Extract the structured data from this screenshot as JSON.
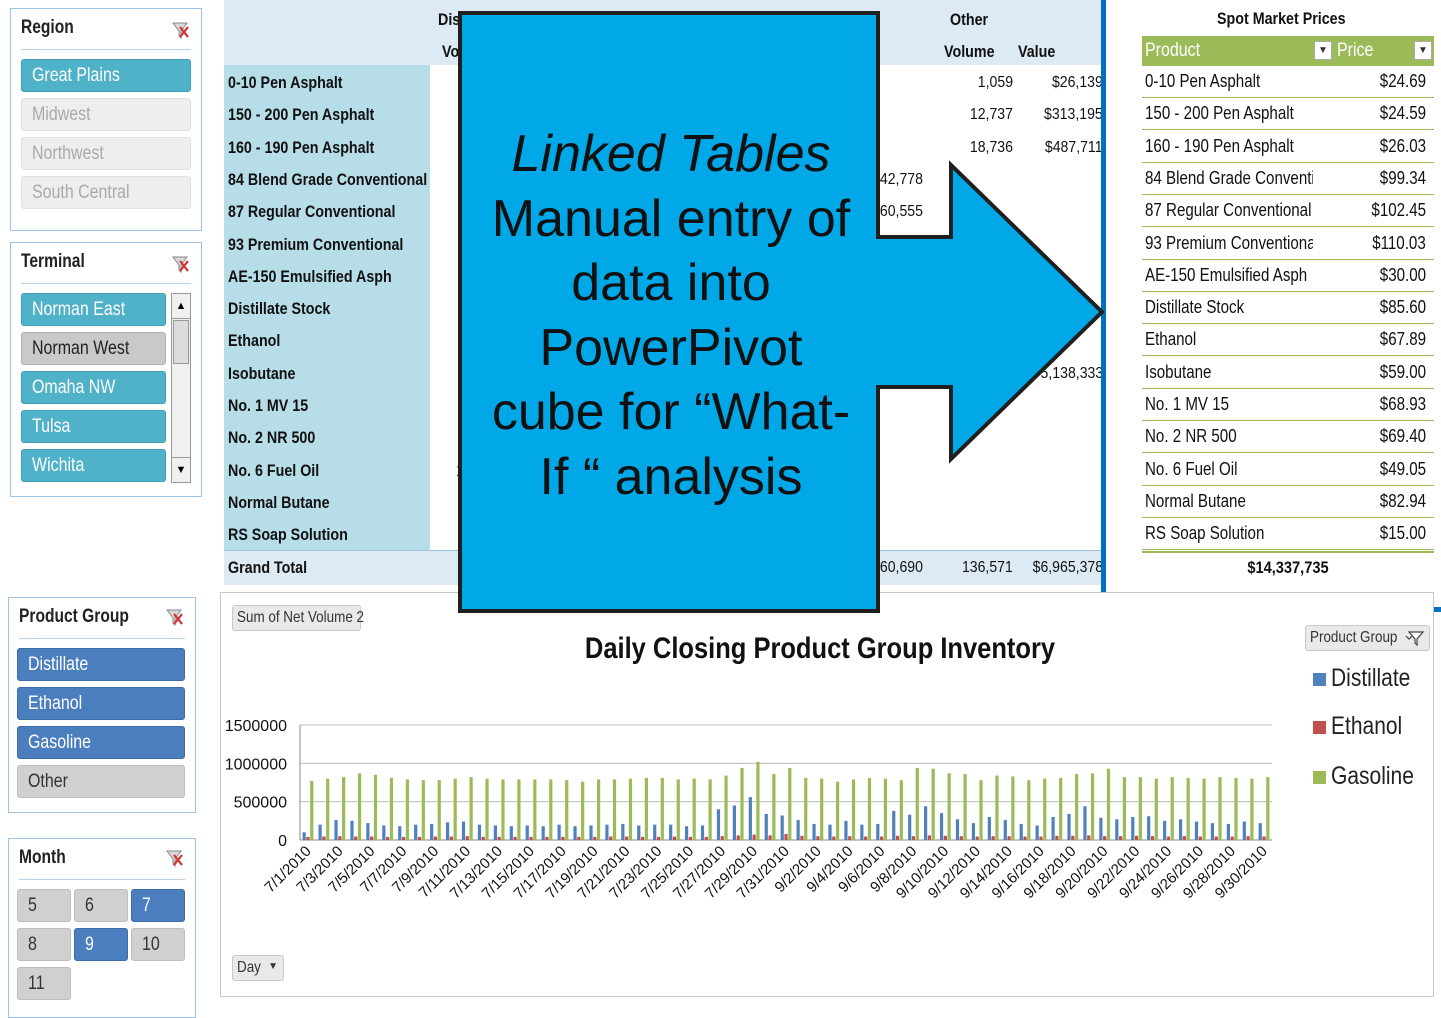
{
  "region_slicer": {
    "title": "Region",
    "items": [
      {
        "label": "Great Plains",
        "state": "selected"
      },
      {
        "label": "Midwest",
        "state": "nodata"
      },
      {
        "label": "Northwest",
        "state": "nodata"
      },
      {
        "label": "South Central",
        "state": "nodata"
      }
    ]
  },
  "terminal_slicer": {
    "title": "Terminal",
    "items": [
      {
        "label": "Norman East",
        "state": "selected"
      },
      {
        "label": "Norman West",
        "state": "unselected"
      },
      {
        "label": "Omaha NW",
        "state": "selected"
      },
      {
        "label": "Tulsa",
        "state": "selected"
      },
      {
        "label": "Wichita",
        "state": "selected"
      }
    ]
  },
  "product_group_slicer": {
    "title": "Product Group",
    "items": [
      {
        "label": "Distillate",
        "state": "selected"
      },
      {
        "label": "Ethanol",
        "state": "selected"
      },
      {
        "label": "Gasoline",
        "state": "selected"
      },
      {
        "label": "Other",
        "state": "unselected"
      }
    ]
  },
  "month_slicer": {
    "title": "Month",
    "items": [
      {
        "label": "5",
        "state": "unselected"
      },
      {
        "label": "6",
        "state": "unselected"
      },
      {
        "label": "7",
        "state": "selected"
      },
      {
        "label": "8",
        "state": "unselected"
      },
      {
        "label": "9",
        "state": "selected"
      },
      {
        "label": "10",
        "state": "unselected"
      },
      {
        "label": "11",
        "state": "unselected"
      }
    ]
  },
  "pivot": {
    "header_top_left": "Dis",
    "header_sub_left": "Vo",
    "header_other": "Other",
    "header_volume": "Volume",
    "header_value": "Value",
    "rows": [
      {
        "label": "0-10 Pen Asphalt",
        "mid": "",
        "volume": "1,059",
        "value": "$26,139"
      },
      {
        "label": "150 - 200 Pen Asphalt",
        "mid": "",
        "volume": "12,737",
        "value": "$313,195"
      },
      {
        "label": "160 - 190 Pen Asphalt",
        "mid": "",
        "volume": "18,736",
        "value": "$487,711"
      },
      {
        "label": "84 Blend Grade Conventional",
        "mid": "42,778",
        "volume": "",
        "value": ""
      },
      {
        "label": "87 Regular Conventional",
        "mid": "60,555",
        "volume": "",
        "value": ""
      },
      {
        "label": "93 Premium Conventional",
        "mid": "",
        "volume": "",
        "value": ""
      },
      {
        "label": "AE-150 Emulsified Asph",
        "mid": "",
        "volume": "",
        "value": ""
      },
      {
        "label": "Distillate Stock",
        "mid": "",
        "volume": "",
        "value": ""
      },
      {
        "label": "Ethanol",
        "mid": "",
        "volume": "",
        "value": ""
      },
      {
        "label": "Isobutane",
        "mid": "",
        "volume": "",
        "value": "5,138,333"
      },
      {
        "label": "No. 1 MV 15",
        "mid": "",
        "volume": "",
        "value": ""
      },
      {
        "label": "No. 2 NR 500",
        "mid": "",
        "volume": "",
        "value": ""
      },
      {
        "label": "No. 6 Fuel Oil",
        "mid": "",
        "volume": "",
        "value": ""
      },
      {
        "label": "Normal Butane",
        "mid": "",
        "volume": "",
        "value": ""
      },
      {
        "label": "RS Soap Solution",
        "mid": "",
        "volume": "",
        "value": ""
      }
    ],
    "grand_total_label": "Grand Total",
    "grand_total_mid": "60,690",
    "grand_total_volume": "136,571",
    "grand_total_value": "$6,965,378",
    "left_fragment_row_12": "1"
  },
  "callout": {
    "line1": "Linked Tables",
    "line2": "Manual entry of",
    "line3": "data into",
    "line4": "PowerPivot",
    "line5": "cube for “What-",
    "line6": "If “ analysis"
  },
  "spot": {
    "title": "Spot Market Prices",
    "col_product": "Product",
    "col_price": "Price",
    "rows": [
      {
        "product": "0-10 Pen Asphalt",
        "price": "$24.69"
      },
      {
        "product": "150 - 200 Pen Asphalt",
        "price": "$24.59"
      },
      {
        "product": "160 - 190 Pen Asphalt",
        "price": "$26.03"
      },
      {
        "product": "84 Blend Grade Conventional",
        "price": "$99.34"
      },
      {
        "product": "87 Regular Conventional",
        "price": "$102.45"
      },
      {
        "product": "93 Premium Conventional",
        "price": "$110.03"
      },
      {
        "product": "AE-150 Emulsified Asph",
        "price": "$30.00"
      },
      {
        "product": "Distillate Stock",
        "price": "$85.60"
      },
      {
        "product": "Ethanol",
        "price": "$67.89"
      },
      {
        "product": "Isobutane",
        "price": "$59.00"
      },
      {
        "product": "No. 1 MV 15",
        "price": "$68.93"
      },
      {
        "product": "No. 2 NR 500",
        "price": "$69.40"
      },
      {
        "product": "No. 6 Fuel Oil",
        "price": "$49.05"
      },
      {
        "product": "Normal Butane",
        "price": "$82.94"
      },
      {
        "product": "RS Soap Solution",
        "price": "$15.00"
      }
    ],
    "total": "$14,337,735"
  },
  "chart_controls": {
    "value_field": "Sum of Net Volume 2",
    "legend_filter": "Product Group",
    "axis_field": "Day"
  },
  "colors": {
    "distillate": "#4f81bd",
    "ethanol": "#c0504d",
    "gasoline": "#9bbb59",
    "spot_header": "#9bbb59",
    "callout": "#00a8e8"
  },
  "chart_data": {
    "type": "bar",
    "title": "Daily Closing Product Group Inventory",
    "ylim": [
      0,
      1500000
    ],
    "yticks": [
      0,
      500000,
      1000000,
      1500000
    ],
    "x": [
      "7/1/2010",
      "7/2/2010",
      "7/3/2010",
      "7/4/2010",
      "7/5/2010",
      "7/6/2010",
      "7/7/2010",
      "7/8/2010",
      "7/9/2010",
      "7/10/2010",
      "7/11/2010",
      "7/12/2010",
      "7/13/2010",
      "7/14/2010",
      "7/15/2010",
      "7/16/2010",
      "7/17/2010",
      "7/18/2010",
      "7/19/2010",
      "7/20/2010",
      "7/21/2010",
      "7/22/2010",
      "7/23/2010",
      "7/24/2010",
      "7/25/2010",
      "7/26/2010",
      "7/27/2010",
      "7/28/2010",
      "7/29/2010",
      "7/30/2010",
      "7/31/2010",
      "9/1/2010",
      "9/2/2010",
      "9/3/2010",
      "9/4/2010",
      "9/5/2010",
      "9/6/2010",
      "9/7/2010",
      "9/8/2010",
      "9/9/2010",
      "9/10/2010",
      "9/11/2010",
      "9/12/2010",
      "9/13/2010",
      "9/14/2010",
      "9/15/2010",
      "9/16/2010",
      "9/17/2010",
      "9/18/2010",
      "9/19/2010",
      "9/20/2010",
      "9/21/2010",
      "9/22/2010",
      "9/23/2010",
      "9/24/2010",
      "9/25/2010",
      "9/26/2010",
      "9/27/2010",
      "9/28/2010",
      "9/29/2010",
      "9/30/2010"
    ],
    "x_tick_labels": [
      "7/1/2010",
      "7/3/2010",
      "7/5/2010",
      "7/7/2010",
      "7/9/2010",
      "7/11/2010",
      "7/13/2010",
      "7/15/2010",
      "7/17/2010",
      "7/19/2010",
      "7/21/2010",
      "7/23/2010",
      "7/25/2010",
      "7/27/2010",
      "7/29/2010",
      "7/31/2010",
      "9/2/2010",
      "9/4/2010",
      "9/6/2010",
      "9/8/2010",
      "9/10/2010",
      "9/12/2010",
      "9/14/2010",
      "9/16/2010",
      "9/18/2010",
      "9/20/2010",
      "9/22/2010",
      "9/24/2010",
      "9/26/2010",
      "9/28/2010",
      "9/30/2010"
    ],
    "series": [
      {
        "name": "Distillate",
        "values": [
          100000,
          200000,
          260000,
          250000,
          220000,
          190000,
          180000,
          200000,
          210000,
          230000,
          240000,
          200000,
          190000,
          180000,
          190000,
          180000,
          200000,
          180000,
          190000,
          200000,
          210000,
          190000,
          200000,
          200000,
          180000,
          190000,
          400000,
          450000,
          560000,
          340000,
          320000,
          260000,
          210000,
          200000,
          250000,
          200000,
          210000,
          380000,
          330000,
          440000,
          350000,
          270000,
          220000,
          300000,
          260000,
          210000,
          190000,
          300000,
          340000,
          440000,
          290000,
          270000,
          300000,
          310000,
          250000,
          270000,
          240000,
          220000,
          210000,
          240000,
          220000
        ]
      },
      {
        "name": "Ethanol",
        "values": [
          40000,
          45000,
          50000,
          45000,
          45000,
          40000,
          40000,
          40000,
          45000,
          45000,
          50000,
          40000,
          40000,
          40000,
          40000,
          40000,
          40000,
          40000,
          40000,
          45000,
          45000,
          40000,
          40000,
          45000,
          40000,
          40000,
          50000,
          60000,
          70000,
          60000,
          80000,
          55000,
          50000,
          45000,
          50000,
          45000,
          45000,
          55000,
          50000,
          60000,
          55000,
          50000,
          45000,
          50000,
          50000,
          45000,
          45000,
          55000,
          55000,
          60000,
          50000,
          50000,
          55000,
          50000,
          45000,
          50000,
          45000,
          45000,
          45000,
          50000,
          45000
        ]
      },
      {
        "name": "Gasoline",
        "values": [
          770000,
          800000,
          820000,
          870000,
          850000,
          810000,
          790000,
          780000,
          780000,
          800000,
          820000,
          800000,
          790000,
          790000,
          790000,
          790000,
          780000,
          760000,
          790000,
          790000,
          800000,
          810000,
          810000,
          790000,
          800000,
          790000,
          840000,
          940000,
          1020000,
          860000,
          940000,
          810000,
          800000,
          760000,
          790000,
          810000,
          800000,
          780000,
          940000,
          930000,
          870000,
          860000,
          780000,
          840000,
          830000,
          780000,
          800000,
          810000,
          860000,
          870000,
          930000,
          820000,
          820000,
          800000,
          820000,
          810000,
          800000,
          820000,
          810000,
          800000,
          820000
        ]
      }
    ]
  }
}
